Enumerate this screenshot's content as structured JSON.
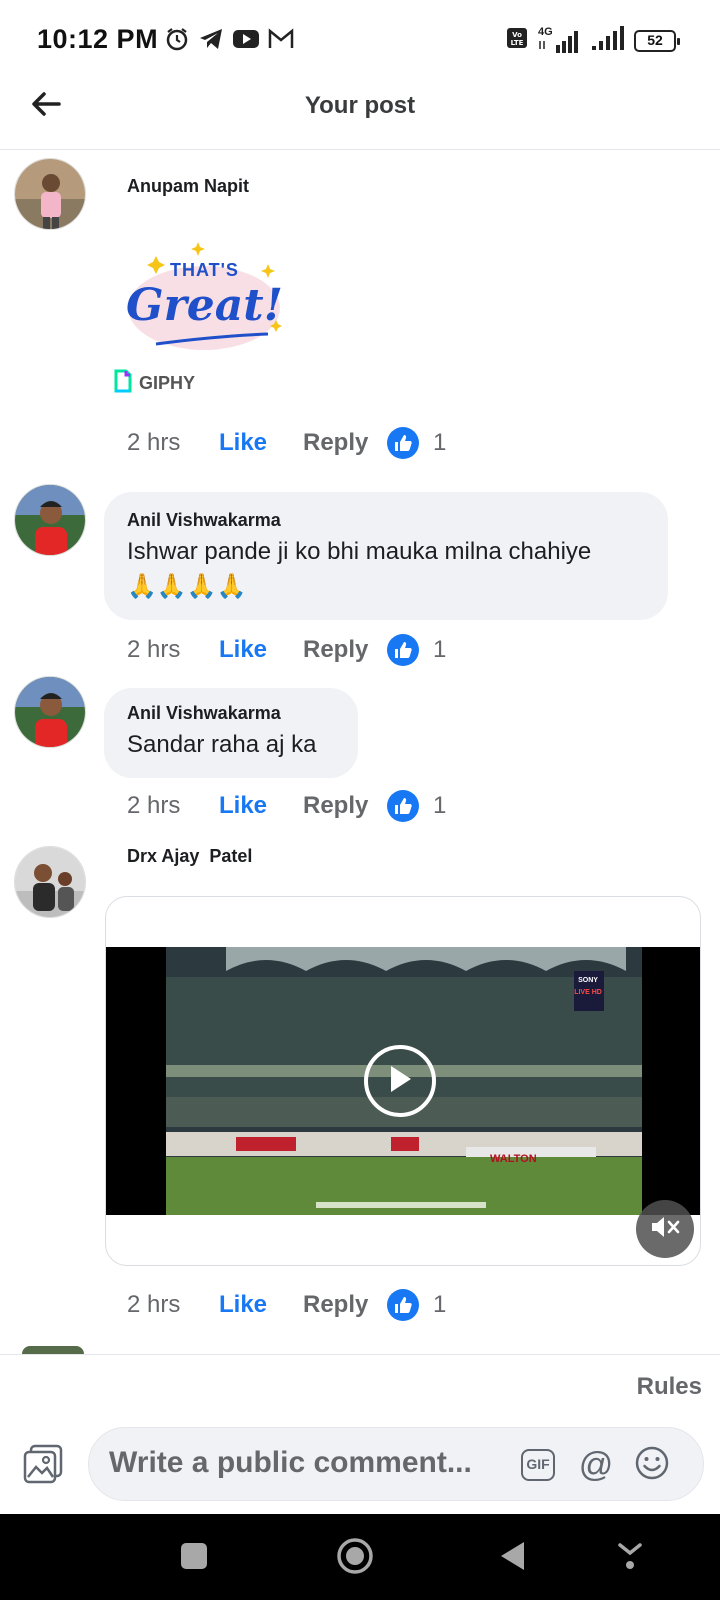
{
  "status_bar": {
    "time": "10:12 PM",
    "left_icons": [
      "alarm-icon",
      "telegram-icon",
      "youtube-icon",
      "gmail-icon"
    ],
    "network_label": "4G",
    "battery": "52"
  },
  "header": {
    "title": "Your post",
    "back_icon": "back-arrow-icon"
  },
  "comments": [
    {
      "author": "Anupam Napit",
      "gif": {
        "line1": "THAT'S",
        "line2": "Great!",
        "source": "GIPHY"
      },
      "time": "2 hrs",
      "like": "Like",
      "reply": "Reply",
      "likes": "1"
    },
    {
      "author": "Anil Vishwakarma",
      "text_line1": "Ishwar pande ji ko bhi mauka milna chahiye",
      "text_line2": "🙏🙏🙏🙏",
      "time": "2 hrs",
      "like": "Like",
      "reply": "Reply",
      "likes": "1"
    },
    {
      "author": "Anil Vishwakarma",
      "text_line1": "Sandar raha aj ka",
      "time": "2 hrs",
      "like": "Like",
      "reply": "Reply",
      "likes": "1"
    },
    {
      "author": "Drx Ajay  Patel",
      "video": {
        "channel_line1": "SONY",
        "channel_line2": "LIVE HD",
        "sponsor": "WALTON"
      },
      "time": "2 hrs",
      "like": "Like",
      "reply": "Reply",
      "likes": "1"
    }
  ],
  "composer": {
    "rules": "Rules",
    "placeholder": "Write a public comment...",
    "gif": "GIF",
    "at": "@"
  },
  "colors": {
    "accent": "#1877f2",
    "bubble": "#f0f2f5",
    "muted": "#65676b"
  }
}
